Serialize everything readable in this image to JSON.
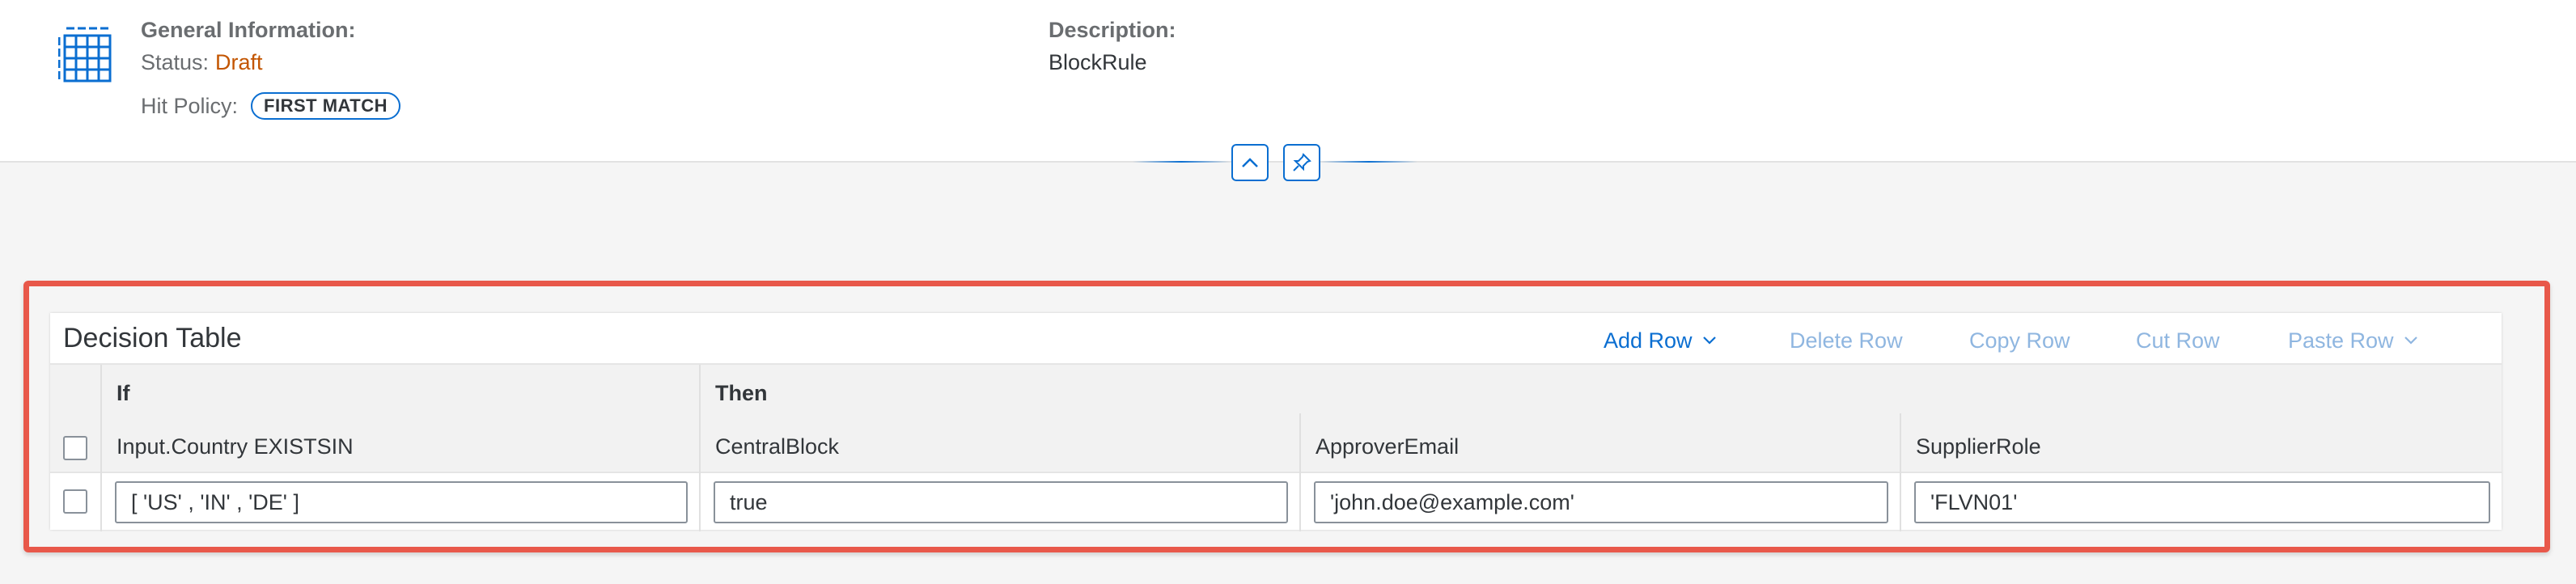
{
  "header": {
    "general_title": "General Information:",
    "status_label": "Status:",
    "status_value": "Draft",
    "hit_policy_label": "Hit Policy:",
    "hit_policy_value": "FIRST MATCH",
    "description_title": "Description:",
    "description_value": "BlockRule",
    "icons": {
      "object": "table-grid-icon",
      "collapse": "chevron-up-icon",
      "pin": "pin-icon"
    }
  },
  "decision_table": {
    "title": "Decision Table",
    "toolbar": {
      "add_row": "Add Row",
      "delete_row": "Delete Row",
      "copy_row": "Copy Row",
      "cut_row": "Cut Row",
      "paste_row": "Paste Row"
    },
    "groups": {
      "if": "If",
      "then": "Then"
    },
    "columns": [
      "Input.Country EXISTSIN",
      "CentralBlock",
      "ApproverEmail",
      "SupplierRole"
    ],
    "rows": [
      {
        "cells": [
          "[ 'US' , 'IN' , 'DE' ]",
          "true",
          "'john.doe@example.com'",
          "'FLVN01'"
        ]
      }
    ]
  },
  "colors": {
    "accent": "#0a6ed1",
    "status_draft": "#c35500",
    "highlight": "#e8584a",
    "disabled_action": "#8fb6e0"
  }
}
